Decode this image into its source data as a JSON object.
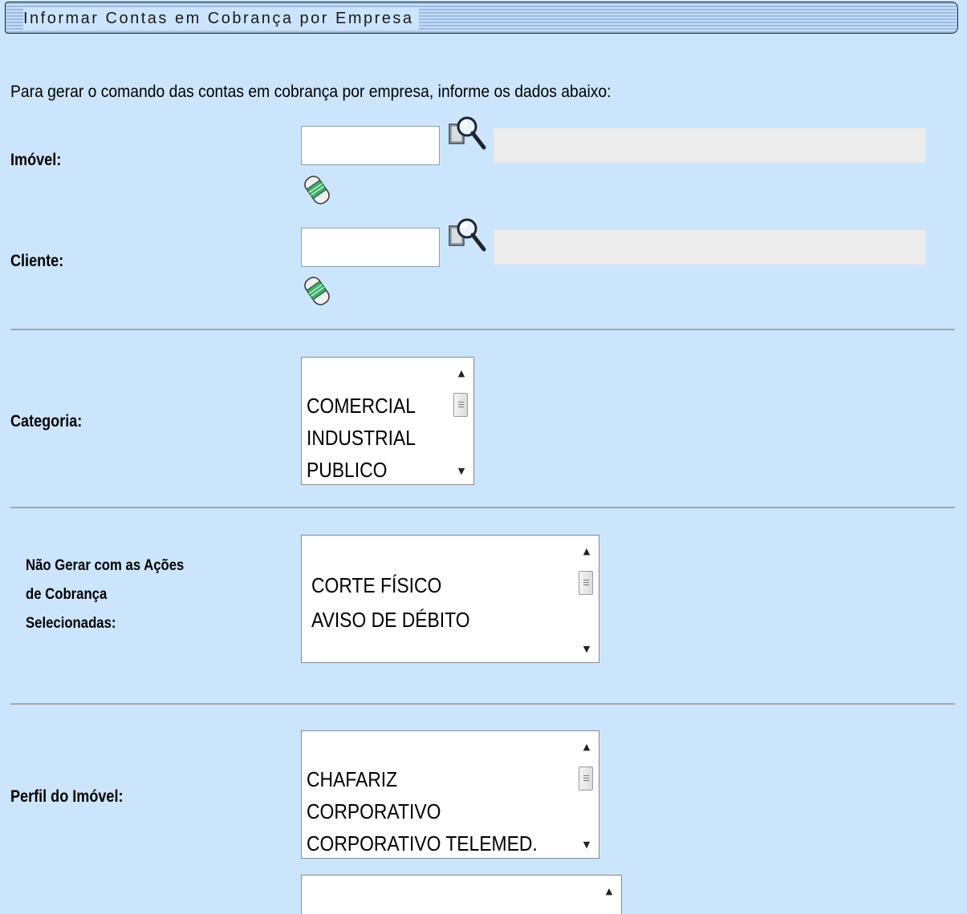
{
  "header": {
    "title": "Informar Contas em Cobrança por Empresa"
  },
  "intro": {
    "text": "Para gerar o comando das contas em cobrança por empresa, informe os dados abaixo:"
  },
  "imovel": {
    "label": "Imóvel:",
    "value": "",
    "description": ""
  },
  "cliente": {
    "label": "Cliente:",
    "value": "",
    "description": ""
  },
  "categoria": {
    "label": "Categoria:",
    "options": [
      "COMERCIAL",
      "INDUSTRIAL",
      "PUBLICO"
    ]
  },
  "acoes": {
    "label_line1": "Não Gerar com as Ações",
    "label_line2": "de Cobrança",
    "label_line3": "Selecionadas:",
    "options": [
      "CORTE FÍSICO",
      "AVISO DE DÉBITO"
    ]
  },
  "perfil": {
    "label": "Perfil do Imóvel:",
    "options": [
      "CHAFARIZ",
      "CORPORATIVO",
      "CORPORATIVO TELEMED."
    ]
  },
  "icons": {
    "lookup": "magnifier-lookup-icon",
    "erase": "eraser-icon",
    "scroll_up": "▲",
    "scroll_down": "▼"
  }
}
